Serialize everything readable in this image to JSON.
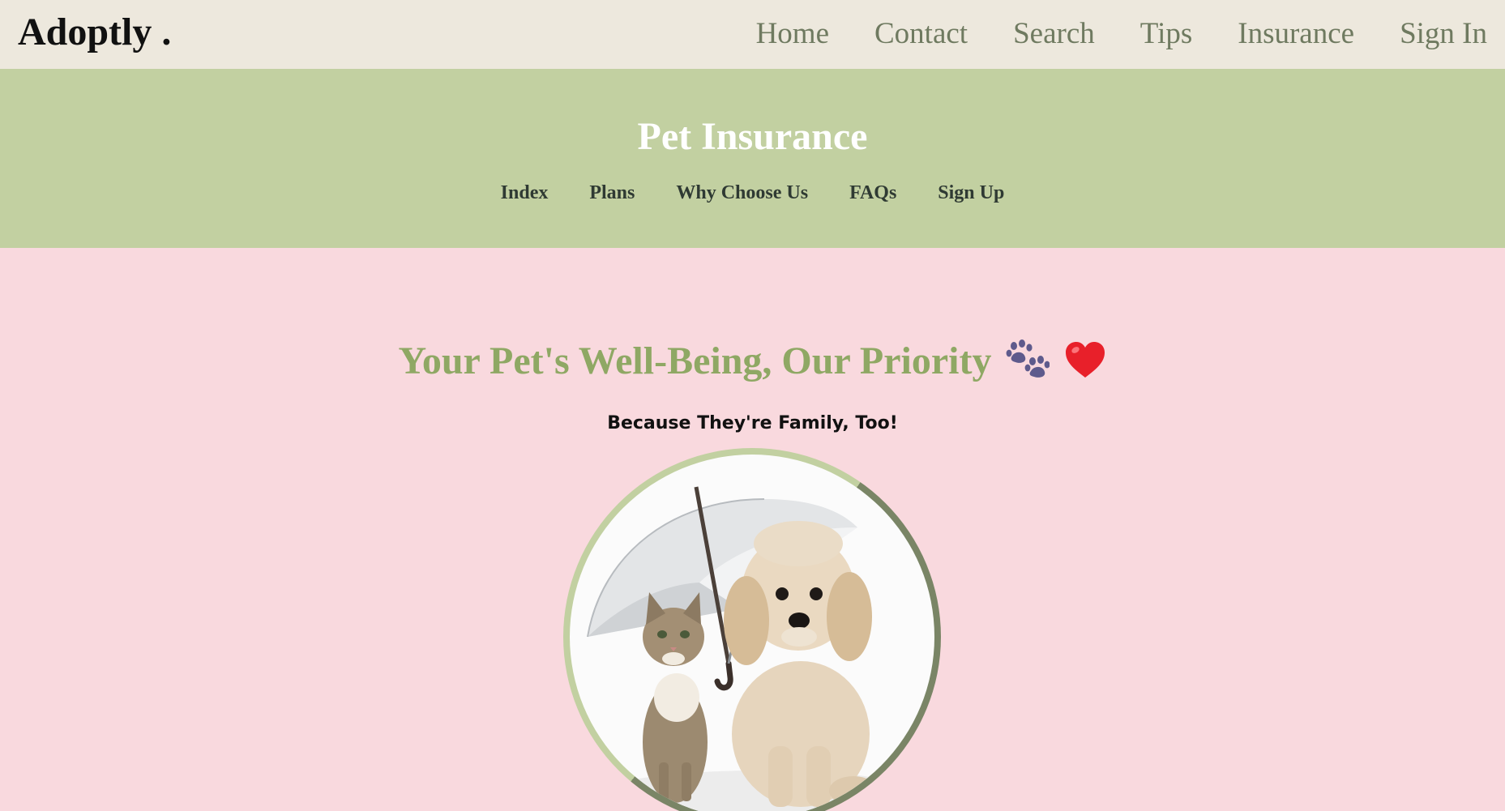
{
  "brand": {
    "name": "Adoptly",
    "dot": "."
  },
  "main_nav": [
    "Home",
    "Contact",
    "Search",
    "Tips",
    "Insurance",
    "Sign In"
  ],
  "page": {
    "title": "Pet Insurance",
    "sub_nav": [
      "Index",
      "Plans",
      "Why Choose Us",
      "FAQs",
      "Sign Up"
    ]
  },
  "hero": {
    "title": "Your Pet's Well-Being, Our Priority",
    "icons": [
      "paw-prints-icon",
      "red-heart-icon"
    ],
    "subtitle": "Because They're Family, Too!",
    "image": "kitten-and-puppy-under-umbrella"
  },
  "colors": {
    "topbar_bg": "#ede8dd",
    "header_bg": "#c2d0a1",
    "page_bg": "#f9d9de",
    "nav_text": "#6f7a60",
    "hero_title": "#8fa864"
  }
}
